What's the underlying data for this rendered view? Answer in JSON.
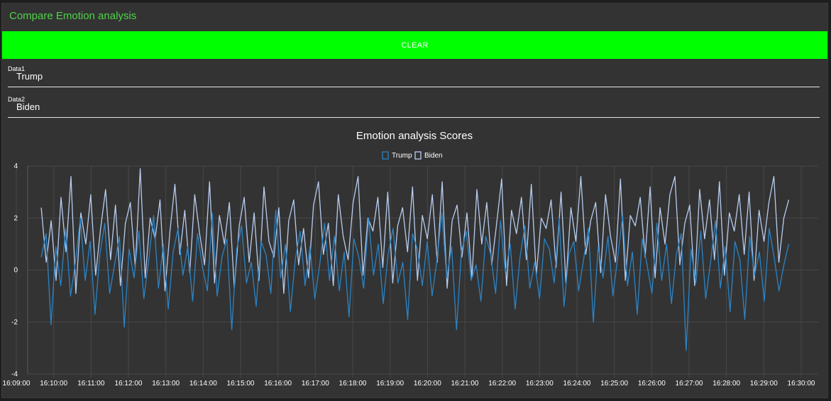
{
  "header": {
    "title": "Compare Emotion analysis"
  },
  "actions": {
    "clear_label": "CLEAR"
  },
  "inputs": [
    {
      "label": "Data1",
      "value": "Trump"
    },
    {
      "label": "Data2",
      "value": "Biden"
    }
  ],
  "chart_data": {
    "type": "line",
    "title": "Emotion analysis Scores",
    "xlabel": "",
    "ylabel": "",
    "ylim": [
      -4,
      4
    ],
    "y_ticks": [
      4,
      2,
      0,
      -2,
      -4
    ],
    "x_ticks": [
      "16:09:00",
      "16:10:00",
      "16:11:00",
      "16:12:00",
      "16:13:00",
      "16:14:00",
      "16:15:00",
      "16:16:00",
      "16:17:00",
      "16:18:00",
      "16:19:00",
      "16:20:00",
      "16:21:00",
      "16:22:00",
      "16:23:00",
      "16:24:00",
      "16:25:00",
      "16:26:00",
      "16:27:00",
      "16:28:00",
      "16:29:00",
      "16:30:00"
    ],
    "grid": true,
    "legend_position": "top-center",
    "series": [
      {
        "name": "Trump",
        "color": "#2b84c6",
        "values": [
          0.5,
          1.4,
          -2.1,
          0.9,
          -0.6,
          1.6,
          -1.0,
          0.3,
          2.0,
          -0.4,
          1.1,
          -1.7,
          0.6,
          1.8,
          -0.9,
          0.2,
          1.3,
          -2.2,
          0.8,
          -0.3,
          1.5,
          -1.1,
          0.4,
          2.1,
          -0.7,
          1.0,
          -1.5,
          0.7,
          1.6,
          -0.2,
          0.9,
          -1.2,
          1.4,
          0.1,
          -0.8,
          2.2,
          -1.0,
          0.5,
          1.2,
          -2.3,
          0.8,
          1.7,
          -0.5,
          0.3,
          -1.4,
          1.1,
          0.6,
          -0.9,
          2.3,
          -0.3,
          1.0,
          -1.6,
          0.4,
          1.5,
          -0.6,
          0.9,
          -1.1,
          0.2,
          1.8,
          -0.4,
          1.3,
          -0.8,
          0.7,
          -1.8,
          1.2,
          0.5,
          -0.7,
          2.0,
          -0.2,
          1.0,
          -1.3,
          0.6,
          1.6,
          -0.5,
          0.3,
          -1.9,
          1.4,
          0.8,
          -0.6,
          1.1,
          -1.0,
          0.4,
          2.2,
          -0.3,
          0.9,
          -2.3,
          0.7,
          1.5,
          -0.4,
          0.2,
          -1.2,
          1.3,
          0.6,
          -0.9,
          1.9,
          -0.1,
          1.0,
          -1.5,
          0.5,
          1.7,
          -0.7,
          0.3,
          -1.1,
          1.2,
          0.8,
          -0.5,
          2.0,
          -1.4,
          0.6,
          1.1,
          -0.8,
          0.4,
          1.6,
          -2.0,
          0.9,
          -0.3,
          1.3,
          -1.0,
          0.5,
          2.1,
          -0.6,
          0.7,
          -1.7,
          1.2,
          0.2,
          -0.9,
          1.8,
          -0.4,
          1.0,
          -1.3,
          0.6,
          1.4,
          -3.1,
          0.8,
          -0.5,
          1.5,
          -1.1,
          0.3,
          1.9,
          -0.7,
          0.9,
          -1.6,
          1.1,
          0.4,
          -1.9,
          1.3,
          -0.2,
          0.7,
          -1.2,
          1.6,
          0.5,
          -0.8,
          0.2,
          1.0
        ]
      },
      {
        "name": "Biden",
        "color": "#b8cdf0",
        "values": [
          2.4,
          0.3,
          1.9,
          -0.4,
          2.8,
          0.7,
          3.6,
          -0.9,
          2.2,
          1.0,
          2.9,
          -0.2,
          1.6,
          3.1,
          0.4,
          2.5,
          -0.6,
          1.8,
          2.6,
          0.1,
          3.9,
          -0.3,
          2.0,
          1.2,
          2.7,
          -0.8,
          1.5,
          3.3,
          0.6,
          2.3,
          -0.1,
          2.9,
          1.4,
          0.2,
          3.4,
          -0.5,
          2.1,
          1.0,
          2.6,
          -0.7,
          1.7,
          2.8,
          0.3,
          2.2,
          -0.4,
          3.2,
          1.1,
          0.5,
          2.4,
          -0.9,
          1.9,
          2.7,
          0.2,
          1.6,
          -0.3,
          2.5,
          3.4,
          0.6,
          1.8,
          -0.6,
          2.9,
          1.3,
          0.4,
          2.6,
          3.6,
          -0.2,
          2.0,
          1.5,
          2.8,
          0.1,
          3.0,
          -0.5,
          1.7,
          2.4,
          0.7,
          3.2,
          -0.4,
          2.1,
          1.2,
          2.9,
          0.3,
          3.4,
          -0.7,
          1.9,
          2.5,
          0.5,
          2.2,
          -0.3,
          3.1,
          1.0,
          2.6,
          0.2,
          1.8,
          3.5,
          -0.6,
          2.3,
          1.4,
          2.8,
          0.4,
          3.3,
          -0.2,
          2.0,
          1.6,
          2.7,
          0.1,
          3.0,
          -0.5,
          2.4,
          1.1,
          3.6,
          0.6,
          1.9,
          2.6,
          -0.1,
          2.9,
          1.3,
          0.3,
          3.5,
          -0.4,
          2.1,
          1.7,
          2.8,
          0.5,
          3.2,
          -0.3,
          2.4,
          1.0,
          2.9,
          3.6,
          0.2,
          1.8,
          2.5,
          -0.6,
          3.1,
          1.2,
          2.7,
          0.4,
          3.4,
          -0.2,
          2.2,
          1.5,
          2.9,
          0.6,
          3.0,
          -0.4,
          2.3,
          1.1,
          2.6,
          3.6,
          0.3,
          2.0,
          2.7
        ]
      }
    ]
  }
}
